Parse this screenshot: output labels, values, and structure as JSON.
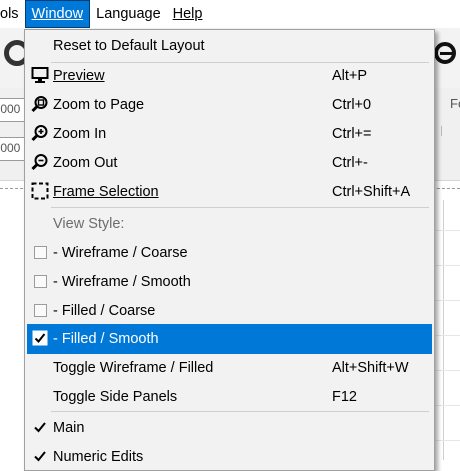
{
  "menubar": {
    "items": [
      "ols",
      "Window",
      "Language",
      "Help"
    ],
    "active": "Window"
  },
  "background": {
    "field_values": [
      ".000",
      ".000"
    ],
    "label_partial": "Fo"
  },
  "window_menu": {
    "reset": "Reset to Default Layout",
    "preview": {
      "label": "Preview",
      "shortcut": "Alt+P",
      "icon": "monitor-icon"
    },
    "zoom_to_page": {
      "label": "Zoom to Page",
      "shortcut": "Ctrl+0",
      "icon": "zoom-page-icon"
    },
    "zoom_in": {
      "label": "Zoom In",
      "shortcut": "Ctrl+=",
      "icon": "zoom-in-icon"
    },
    "zoom_out": {
      "label": "Zoom Out",
      "shortcut": "Ctrl+-",
      "icon": "zoom-out-icon"
    },
    "frame_selection": {
      "label": "Frame Selection",
      "shortcut": "Ctrl+Shift+A",
      "icon": "frame-selection-icon"
    },
    "view_style_header": "View Style:",
    "view_styles": [
      {
        "label": "-  Wireframe / Coarse",
        "checked": false
      },
      {
        "label": "-  Wireframe / Smooth",
        "checked": false
      },
      {
        "label": "-  Filled / Coarse",
        "checked": false
      },
      {
        "label": "-  Filled / Smooth",
        "checked": true
      }
    ],
    "toggle_wireframe": {
      "label": "Toggle Wireframe / Filled",
      "shortcut": "Alt+Shift+W"
    },
    "toggle_side_panels": {
      "label": "Toggle Side Panels",
      "shortcut": "F12"
    },
    "panels": [
      {
        "label": "Main",
        "checked": true
      },
      {
        "label": "Numeric Edits",
        "checked": true
      }
    ]
  },
  "colors": {
    "accent": "#0078d7",
    "menu_bg": "#f2f2f2",
    "disabled_text": "#6d6d6d"
  }
}
